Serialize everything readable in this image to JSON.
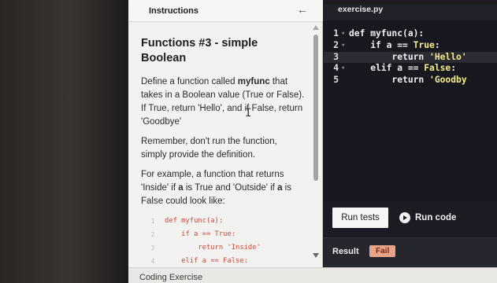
{
  "instructions": {
    "tab_label": "Instructions",
    "back_icon": "arrow-left-icon",
    "lesson_title": "Functions #3 - simple Boolean",
    "para1_a": "Define a function called ",
    "para1_bold": "myfunc",
    "para1_b": " that takes in a Boolean value (True or False). If True, return 'Hello', and if False, return 'Goodbye'",
    "para2": "Remember, don't run the function, simply provide the definition.",
    "para3_a": "For example, a function that returns 'Inside' if ",
    "para3_bold1": "a",
    "para3_b": " is True and 'Outside' if ",
    "para3_bold2": "a",
    "para3_c": " is False could look like:",
    "example_lines": [
      {
        "num": "1",
        "text": "def myfunc(a):"
      },
      {
        "num": "2",
        "text": "    if a == True:"
      },
      {
        "num": "3",
        "text": "        return 'Inside'"
      },
      {
        "num": "4",
        "text": "    elif a == False:"
      }
    ]
  },
  "editor": {
    "file_tab": "exercise.py",
    "lines": [
      {
        "num": "1",
        "fold": "▾",
        "text": "def myfunc(a):"
      },
      {
        "num": "2",
        "fold": "▾",
        "text": "    if a == True:"
      },
      {
        "num": "3",
        "fold": "",
        "text": "        return 'Hello'"
      },
      {
        "num": "4",
        "fold": "▾",
        "text": "    elif a == False:"
      },
      {
        "num": "5",
        "fold": "",
        "text": "        return 'Goodby"
      }
    ]
  },
  "actions": {
    "run_tests_label": "Run tests",
    "run_code_label": "Run code",
    "play_icon": "play-circle-icon"
  },
  "result": {
    "label": "Result",
    "status": "Fail"
  },
  "footer": {
    "label": "Coding Exercise"
  }
}
